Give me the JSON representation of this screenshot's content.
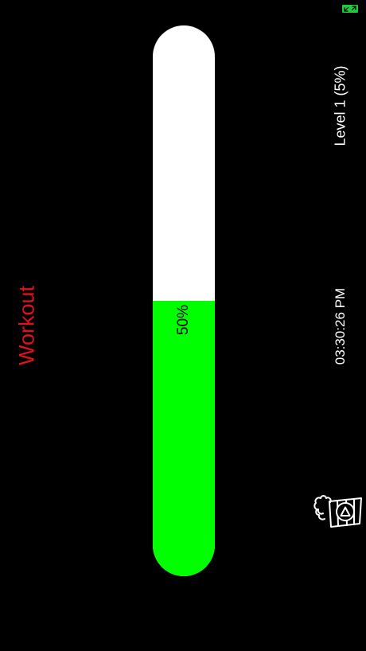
{
  "status": {
    "icon": "expand-arrows-icon",
    "color": "#1fcc3a"
  },
  "title": {
    "text": "Workout",
    "color": "#e0121b"
  },
  "level": {
    "text": "Level 1 (5%)"
  },
  "clock": {
    "time": "03:30:26 PM"
  },
  "progress": {
    "value": 50,
    "label": "50%",
    "fill_color": "#00ff00",
    "track_color": "#ffffff"
  },
  "action": {
    "icon": "popcorn-play-icon"
  }
}
